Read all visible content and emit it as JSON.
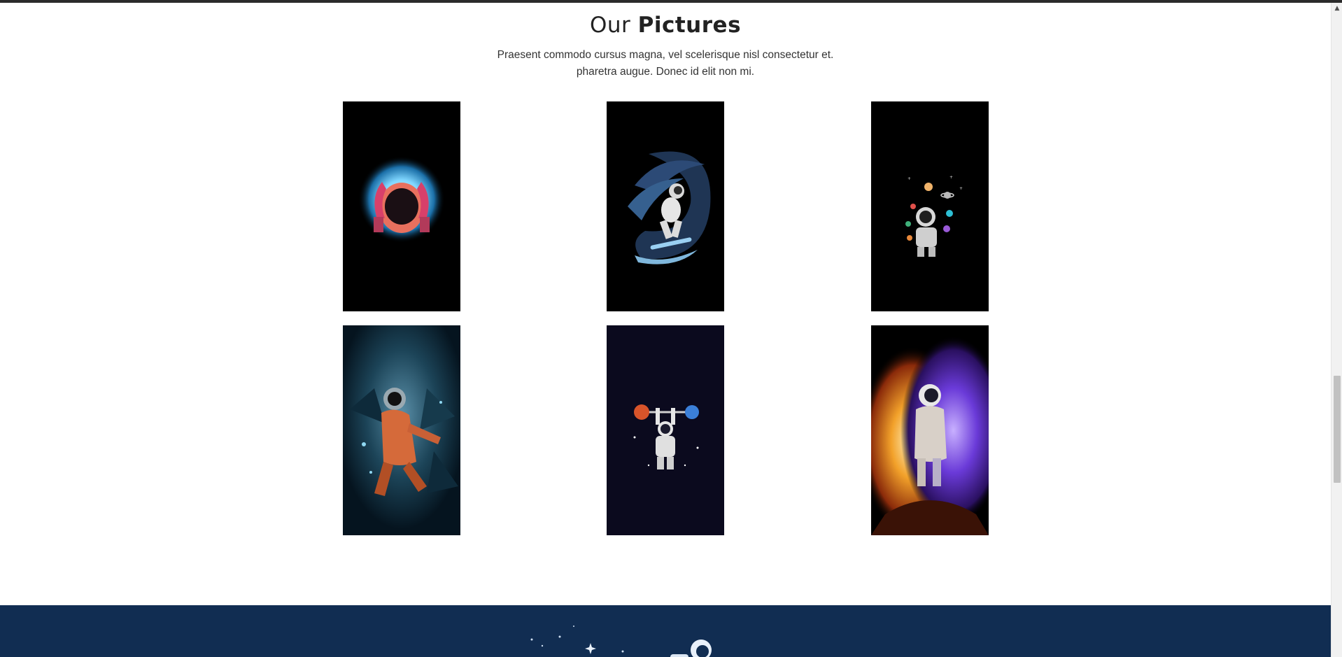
{
  "section": {
    "title_light": "Our",
    "title_bold": "Pictures",
    "description_line1": "Praesent commodo cursus magna, vel scelerisque nisl consectetur et.",
    "description_line2": "pharetra augue. Donec id elit non mi."
  },
  "gallery": {
    "items": [
      {
        "name": "astronaut-hands-helmet",
        "bg": "#000000"
      },
      {
        "name": "astronaut-surfing-wave",
        "bg": "#000000"
      },
      {
        "name": "astronaut-juggling-planets",
        "bg": "#000000"
      },
      {
        "name": "astronaut-exploding-nebula",
        "bg": "#05141f"
      },
      {
        "name": "astronaut-lifting-planets",
        "bg": "#0b0a1e"
      },
      {
        "name": "astronaut-cosmic-fire",
        "bg": "#000000"
      }
    ]
  },
  "footer": {
    "background": "#112d52"
  },
  "scrollbar": {
    "up_arrow": "▲"
  }
}
